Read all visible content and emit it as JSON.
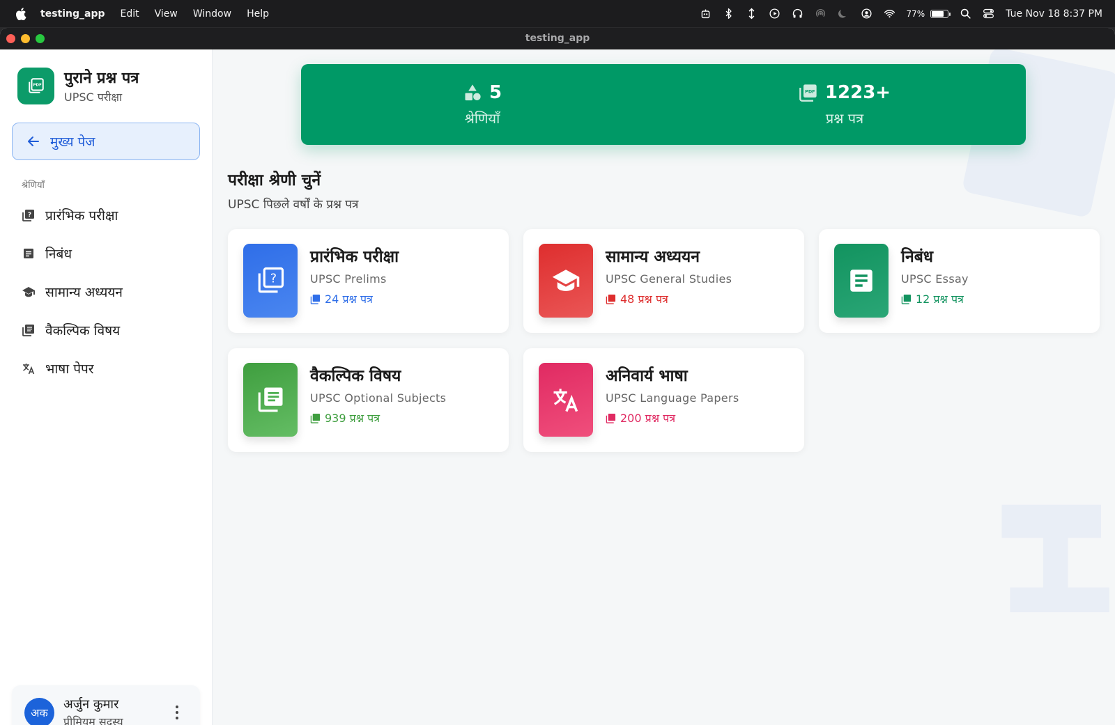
{
  "menubar": {
    "app_name": "testing_app",
    "menus": [
      "Edit",
      "View",
      "Window",
      "Help"
    ],
    "battery_percent": "77%",
    "battery_level": 0.77,
    "clock": "Tue Nov 18  8:37 PM"
  },
  "window": {
    "title": "testing_app"
  },
  "sidebar": {
    "brand_title": "पुराने प्रश्न पत्र",
    "brand_subtitle": "UPSC परीक्षा",
    "home_label": "मुख्य पेज",
    "section_label": "श्रेणियाँ",
    "items": [
      {
        "label": "प्रारंभिक परीक्षा",
        "icon": "quiz-icon"
      },
      {
        "label": "निबंध",
        "icon": "article-icon"
      },
      {
        "label": "सामान्य अध्ययन",
        "icon": "school-icon"
      },
      {
        "label": "वैकल्पिक विषय",
        "icon": "library-books-icon"
      },
      {
        "label": "भाषा पेपर",
        "icon": "translate-icon"
      }
    ],
    "user": {
      "initials": "अक",
      "name": "अर्जुन कुमार",
      "role": "प्रीमियम सदस्य"
    }
  },
  "stats": {
    "categories_value": "5",
    "categories_label": "श्रेणियाँ",
    "papers_value": "1223+",
    "papers_label": "प्रश्न पत्र"
  },
  "main": {
    "title": "परीक्षा श्रेणी चुनें",
    "subtitle": "UPSC पिछले वर्षों के प्रश्न पत्र"
  },
  "cards": [
    {
      "title": "प्रारंभिक परीक्षा",
      "subtitle": "UPSC Prelims",
      "count": "24 प्रश्न पत्र",
      "color": "#2f6ee8",
      "color2": "#4a86f0",
      "icon": "quiz-icon"
    },
    {
      "title": "सामान्य अध्ययन",
      "subtitle": "UPSC General Studies",
      "count": "48 प्रश्न पत्र",
      "color": "#de2e2e",
      "color2": "#ea5656",
      "icon": "school-icon"
    },
    {
      "title": "निबंध",
      "subtitle": "UPSC Essay",
      "count": "12 प्रश्न पत्र",
      "color": "#12935f",
      "color2": "#2aa676",
      "icon": "article-icon"
    },
    {
      "title": "वैकल्पिक विषय",
      "subtitle": "UPSC Optional Subjects",
      "count": "939 प्रश्न पत्र",
      "color": "#3f9e3f",
      "color2": "#64bd64",
      "icon": "library-books-icon"
    },
    {
      "title": "अनिवार्य भाषा",
      "subtitle": "UPSC Language Papers",
      "count": "200 प्रश्न पत्र",
      "color": "#e02a62",
      "color2": "#f04f7c",
      "icon": "translate-icon"
    }
  ]
}
